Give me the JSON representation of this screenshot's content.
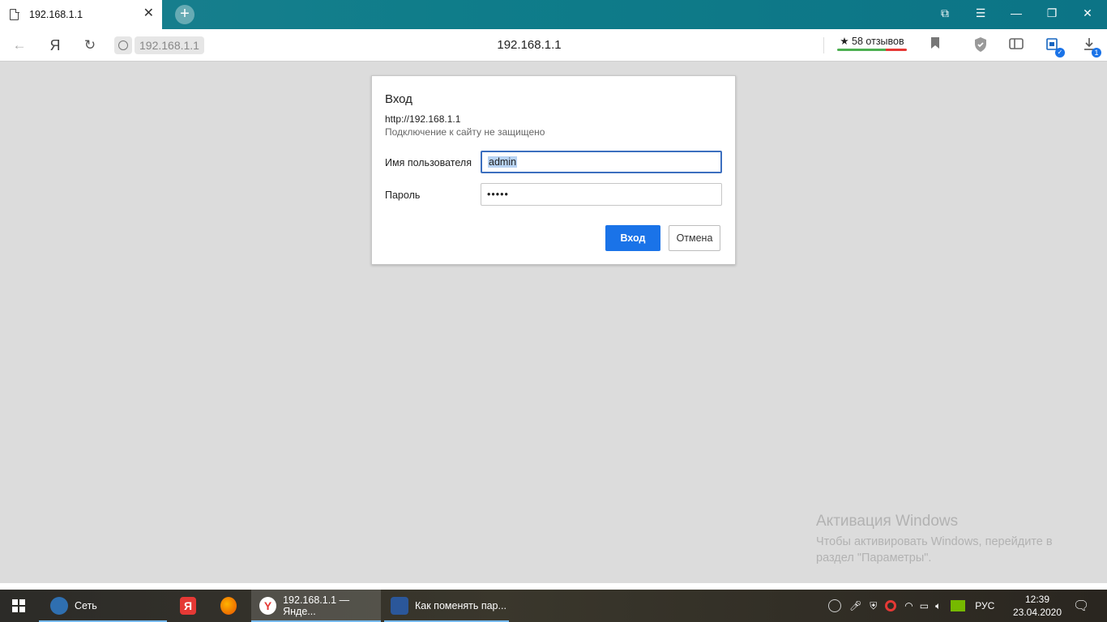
{
  "browser": {
    "tab_title": "192.168.1.1",
    "tab_close": "✕",
    "new_tab": "+",
    "address_host": "192.168.1.1",
    "address_center": "192.168.1.1",
    "reviews_label": "★ 58 отзывов",
    "download_badge": "1"
  },
  "dialog": {
    "title": "Вход",
    "url": "http://192.168.1.1",
    "warning": "Подключение к сайту не защищено",
    "username_label": "Имя пользователя",
    "username_value": "admin",
    "password_label": "Пароль",
    "password_value": "•••••",
    "submit_label": "Вход",
    "cancel_label": "Отмена"
  },
  "watermark": {
    "title": "Активация Windows",
    "text": "Чтобы активировать Windows, перейдите в раздел \"Параметры\"."
  },
  "taskbar": {
    "items": [
      {
        "label": "Сеть"
      },
      {
        "label": "192.168.1.1 — Янде..."
      },
      {
        "label": "Как поменять пар..."
      }
    ],
    "language": "РУС",
    "time": "12:39",
    "date": "23.04.2020"
  },
  "colors": {
    "accent": "#1a73e8",
    "tabstrip": "#0f7d8a",
    "page_bg": "#dcdcdc"
  }
}
